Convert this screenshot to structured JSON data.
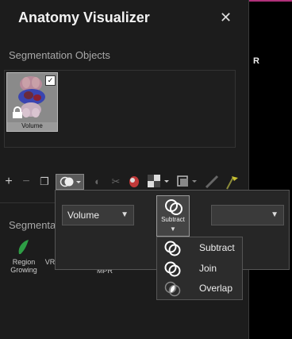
{
  "app": {
    "title": "Anatomy Visualizer",
    "close_glyph": "✕"
  },
  "segmentation_objects": {
    "label": "Segmentation Objects",
    "items": [
      {
        "label": "Volume",
        "checked": true
      }
    ]
  },
  "toolbar": {
    "items": [
      {
        "name": "add-icon",
        "glyph": "+"
      },
      {
        "name": "remove-icon",
        "glyph": "−"
      },
      {
        "name": "duplicate-icon",
        "glyph": "❐"
      },
      {
        "name": "boolean-ops-icon",
        "glyph": ""
      },
      {
        "name": "invert-icon",
        "glyph": "◐"
      },
      {
        "name": "cut-icon",
        "glyph": "✂"
      },
      {
        "name": "organ-icon",
        "glyph": ""
      },
      {
        "name": "checker-icon",
        "glyph": ""
      },
      {
        "name": "layers-icon",
        "glyph": ""
      },
      {
        "name": "ruler-icon",
        "glyph": ""
      },
      {
        "name": "flag-icon",
        "glyph": ""
      }
    ]
  },
  "segmentation_tools": {
    "label_visible": "Segmenta",
    "tools": [
      {
        "label_line1": "Region",
        "label_line2": "Growing"
      },
      {
        "label_line1": "VR",
        "label_line2": ""
      },
      {
        "label_line1": "MPR",
        "label_line2": ""
      }
    ],
    "apply_label": "ply"
  },
  "boolean_popup": {
    "source_select": "Volume",
    "target_select": "",
    "operation_button": {
      "label": "Subtract"
    },
    "menu": [
      {
        "label": "Subtract",
        "icon": "subtract-icon"
      },
      {
        "label": "Join",
        "icon": "join-icon"
      },
      {
        "label": "Overlap",
        "icon": "overlap-icon"
      }
    ]
  },
  "viewport": {
    "orientation_label": "R"
  },
  "colors": {
    "accent": "#b0307a",
    "panel": "#1c1c1c",
    "region_growing": "#2e9e45"
  }
}
